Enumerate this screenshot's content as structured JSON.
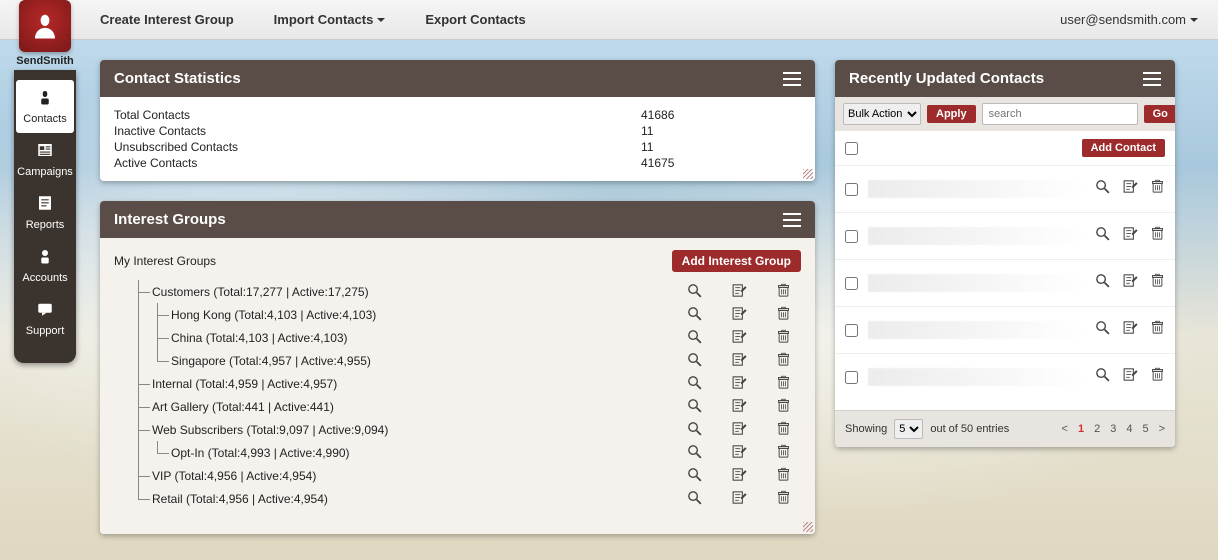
{
  "brand": {
    "name": "SendSmith"
  },
  "topnav": {
    "create": "Create Interest Group",
    "import": "Import Contacts",
    "export": "Export Contacts",
    "user": "user@sendsmith.com"
  },
  "sidebar": [
    {
      "label": "Contacts",
      "icon": "contacts",
      "active": true
    },
    {
      "label": "Campaigns",
      "icon": "news",
      "active": false
    },
    {
      "label": "Reports",
      "icon": "report",
      "active": false
    },
    {
      "label": "Accounts",
      "icon": "account",
      "active": false
    },
    {
      "label": "Support",
      "icon": "support",
      "active": false
    }
  ],
  "stats": {
    "title": "Contact Statistics",
    "rows": [
      {
        "label": "Total Contacts",
        "value": "41686"
      },
      {
        "label": "Inactive Contacts",
        "value": "11"
      },
      {
        "label": "Unsubscribed Contacts",
        "value": "11"
      },
      {
        "label": "Active Contacts",
        "value": "41675"
      }
    ]
  },
  "groups": {
    "title": "Interest Groups",
    "root": "My Interest Groups",
    "add_btn": "Add Interest Group",
    "items": [
      {
        "depth": 1,
        "last": false,
        "label": "Customers (Total:17,277 | Active:17,275)"
      },
      {
        "depth": 2,
        "last": false,
        "parent_cont": true,
        "label": "Hong Kong (Total:4,103 | Active:4,103)"
      },
      {
        "depth": 2,
        "last": false,
        "parent_cont": true,
        "label": "China (Total:4,103 | Active:4,103)"
      },
      {
        "depth": 2,
        "last": true,
        "parent_cont": true,
        "label": "Singapore (Total:4,957 | Active:4,955)"
      },
      {
        "depth": 1,
        "last": false,
        "label": "Internal (Total:4,959 | Active:4,957)"
      },
      {
        "depth": 1,
        "last": false,
        "label": "Art Gallery (Total:441 | Active:441)"
      },
      {
        "depth": 1,
        "last": false,
        "label": "Web Subscribers (Total:9,097 | Active:9,094)"
      },
      {
        "depth": 2,
        "last": true,
        "parent_cont": true,
        "label": "Opt-In (Total:4,993 | Active:4,990)"
      },
      {
        "depth": 1,
        "last": false,
        "label": "VIP (Total:4,956 | Active:4,954)"
      },
      {
        "depth": 1,
        "last": true,
        "label": "Retail (Total:4,956 | Active:4,954)"
      }
    ]
  },
  "recent": {
    "title": "Recently Updated Contacts",
    "bulk_label": "Bulk Action",
    "apply": "Apply",
    "search_placeholder": "search",
    "go": "Go",
    "add_contact": "Add Contact",
    "contacts_count": 5,
    "showing_left": "Showing",
    "showing_select": "5",
    "showing_right": "out of 50 entries",
    "pages": [
      "1",
      "2",
      "3",
      "4",
      "5"
    ]
  }
}
